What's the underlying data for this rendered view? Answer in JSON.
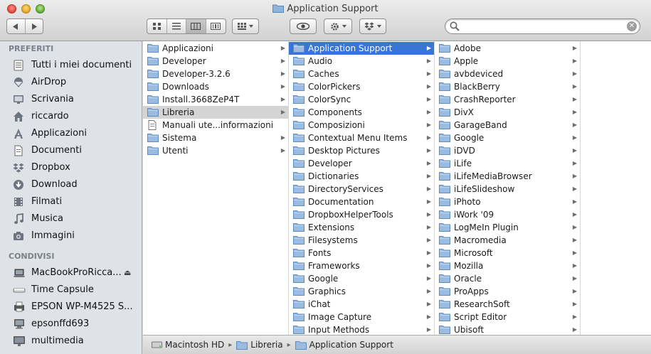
{
  "window": {
    "title": "Application Support"
  },
  "search": {
    "placeholder": "",
    "value": "",
    "clear_symbol": "✕"
  },
  "sidebar": {
    "favorites_header": "PREFERITI",
    "favorites": [
      {
        "label": "Tutti i miei documenti",
        "icon": "all-documents-icon"
      },
      {
        "label": "AirDrop",
        "icon": "airdrop-icon"
      },
      {
        "label": "Scrivania",
        "icon": "desktop-icon"
      },
      {
        "label": "riccardo",
        "icon": "home-icon"
      },
      {
        "label": "Applicazioni",
        "icon": "applications-icon"
      },
      {
        "label": "Documenti",
        "icon": "documents-icon"
      },
      {
        "label": "Dropbox",
        "icon": "dropbox-icon"
      },
      {
        "label": "Download",
        "icon": "download-icon"
      },
      {
        "label": "Filmati",
        "icon": "movies-icon"
      },
      {
        "label": "Musica",
        "icon": "music-icon"
      },
      {
        "label": "Immagini",
        "icon": "pictures-icon"
      }
    ],
    "shared_header": "CONDIVISI",
    "shared": [
      {
        "label": "MacBookProRicca...",
        "icon": "laptop-icon",
        "eject": "⏏"
      },
      {
        "label": "Time Capsule",
        "icon": "time-capsule-icon"
      },
      {
        "label": "EPSON WP-M4525 S...",
        "icon": "printer-icon"
      },
      {
        "label": "epsonffd693",
        "icon": "computer-icon"
      },
      {
        "label": "multimedia",
        "icon": "display-icon"
      }
    ]
  },
  "columns": {
    "c1": [
      {
        "label": "Applicazioni",
        "arrow": true
      },
      {
        "label": "Developer",
        "arrow": true
      },
      {
        "label": "Developer-3.2.6",
        "arrow": true
      },
      {
        "label": "Downloads",
        "arrow": true
      },
      {
        "label": "Install.3668ZeP4T",
        "arrow": true
      },
      {
        "label": "Libreria",
        "arrow": true,
        "selected": "inactive"
      },
      {
        "label": "Manuali ute...informazioni",
        "arrow": false,
        "doc": true
      },
      {
        "label": "Sistema",
        "arrow": true
      },
      {
        "label": "Utenti",
        "arrow": true
      }
    ],
    "c2": [
      "Application Support",
      "Audio",
      "Caches",
      "ColorPickers",
      "ColorSync",
      "Components",
      "Composizioni",
      "Contextual Menu Items",
      "Desktop Pictures",
      "Developer",
      "Dictionaries",
      "DirectoryServices",
      "Documentation",
      "DropboxHelperTools",
      "Extensions",
      "Filesystems",
      "Fonts",
      "Frameworks",
      "Google",
      "Graphics",
      "iChat",
      "Image Capture",
      "Input Methods"
    ],
    "c3": [
      "Adobe",
      "Apple",
      "avbdeviced",
      "BlackBerry",
      "CrashReporter",
      "DivX",
      "GarageBand",
      "Google",
      "iDVD",
      "iLife",
      "iLifeMediaBrowser",
      "iLifeSlideshow",
      "iPhoto",
      "iWork '09",
      "LogMeIn Plugin",
      "Macromedia",
      "Microsoft",
      "Mozilla",
      "Oracle",
      "ProApps",
      "ResearchSoft",
      "Script Editor",
      "Ubisoft"
    ]
  },
  "pathbar": {
    "crumbs": [
      "Macintosh HD",
      "Libreria",
      "Application Support"
    ]
  },
  "colors": {
    "selection": "#3875d7",
    "folder": "#8fb3d9",
    "sidebar": "#dfe3e8"
  }
}
